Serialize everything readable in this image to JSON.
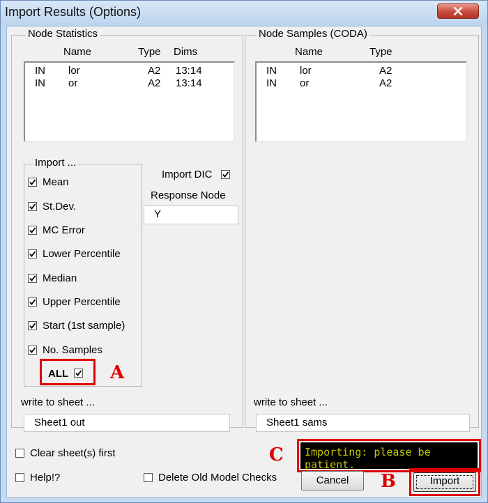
{
  "window": {
    "title": "Import Results (Options)"
  },
  "node_statistics": {
    "group_label": "Node Statistics",
    "headers": {
      "name": "Name",
      "type": "Type",
      "dims": "Dims"
    },
    "rows": [
      {
        "prefix": "IN",
        "name": "lor",
        "type": "A2",
        "dims": "13:14"
      },
      {
        "prefix": "IN",
        "name": "or",
        "type": "A2",
        "dims": "13:14"
      }
    ]
  },
  "node_samples": {
    "group_label": "Node Samples (CODA)",
    "headers": {
      "name": "Name",
      "type": "Type"
    },
    "rows": [
      {
        "prefix": "IN",
        "name": "lor",
        "type": "A2"
      },
      {
        "prefix": "IN",
        "name": "or",
        "type": "A2"
      }
    ]
  },
  "import": {
    "group_label": "Import ...",
    "options": [
      {
        "label": "Mean",
        "checked": true
      },
      {
        "label": "St.Dev.",
        "checked": true
      },
      {
        "label": "MC Error",
        "checked": true
      },
      {
        "label": "Lower Percentile",
        "checked": true
      },
      {
        "label": "Median",
        "checked": true
      },
      {
        "label": "Upper Percentile",
        "checked": true
      },
      {
        "label": "Start (1st sample)",
        "checked": true
      },
      {
        "label": "No. Samples",
        "checked": true
      }
    ],
    "all_label": "ALL",
    "all_checked": true
  },
  "import_dic": {
    "label": "Import DIC",
    "checked": true
  },
  "response_node": {
    "label": "Response Node",
    "value": "Y"
  },
  "write_left": {
    "label": "write to sheet ...",
    "value": "Sheet1 out"
  },
  "write_right": {
    "label": "write to sheet ...",
    "value": "Sheet1 sams"
  },
  "clear_sheets": {
    "label": "Clear sheet(s) first",
    "checked": false
  },
  "help": {
    "label": "Help!?",
    "checked": false
  },
  "delete_checks": {
    "label": "Delete Old Model Checks",
    "checked": false
  },
  "status_text": "Importing: please be patient.",
  "buttons": {
    "cancel": "Cancel",
    "import": "Import"
  },
  "annotations": {
    "a": "A",
    "b": "B",
    "c": "C"
  },
  "colors": {
    "annotation": "#e00000",
    "status_bg": "#000000",
    "status_text": "#c8c800",
    "window_frame": "#c4daf2"
  }
}
